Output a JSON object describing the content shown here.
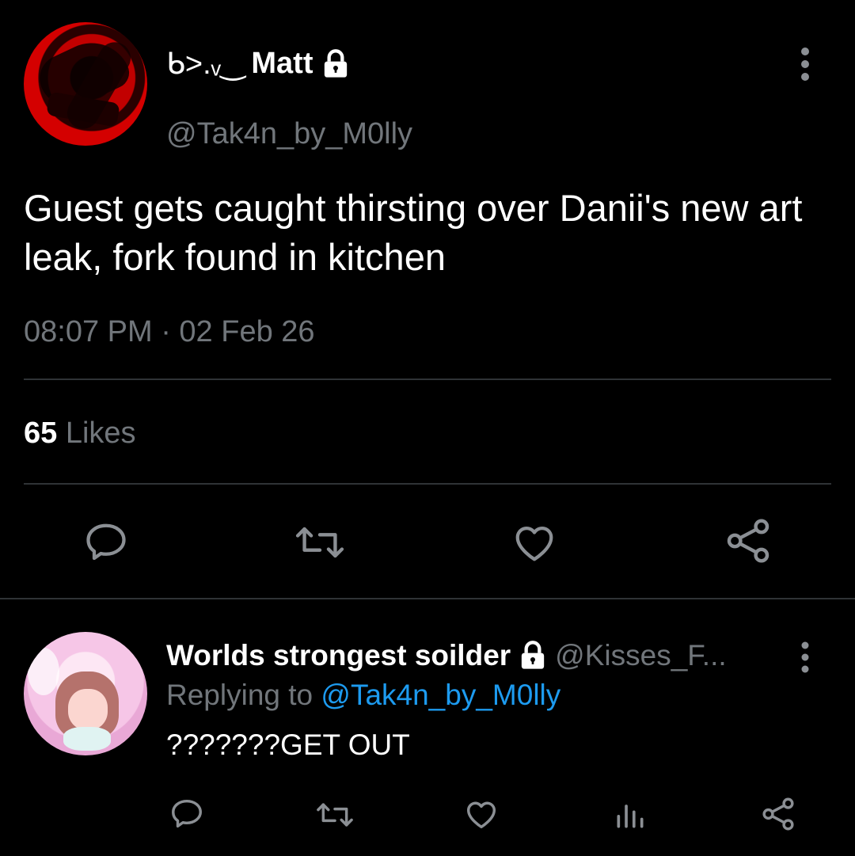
{
  "main_tweet": {
    "display_name_prefix": "ᑲ>.ᵥ‿",
    "display_name": "Matt",
    "handle": "@Tak4n_by_M0lly",
    "text": "Guest gets caught thirsting over Danii's new art leak, fork found in kitchen",
    "timestamp": "08:07 PM · 02 Feb 26",
    "likes_count": "65",
    "likes_label": "Likes",
    "icons": [
      "lock-icon",
      "more-icon",
      "reply-icon",
      "retweet-icon",
      "like-icon",
      "share-icon"
    ]
  },
  "reply_tweet": {
    "display_name": "Worlds strongest soilder",
    "handle": "@Kisses_F...",
    "replying_prefix": "Replying to",
    "replying_handle": "@Tak4n_by_M0lly",
    "text": "???????GET OUT",
    "icons": [
      "lock-icon",
      "more-icon",
      "reply-icon",
      "retweet-icon",
      "like-icon",
      "analytics-icon",
      "share-icon"
    ]
  },
  "colors": {
    "background": "#000000",
    "text": "#ffffff",
    "muted": "#71767b",
    "link": "#1d9bf0",
    "divider": "#2f3336"
  }
}
